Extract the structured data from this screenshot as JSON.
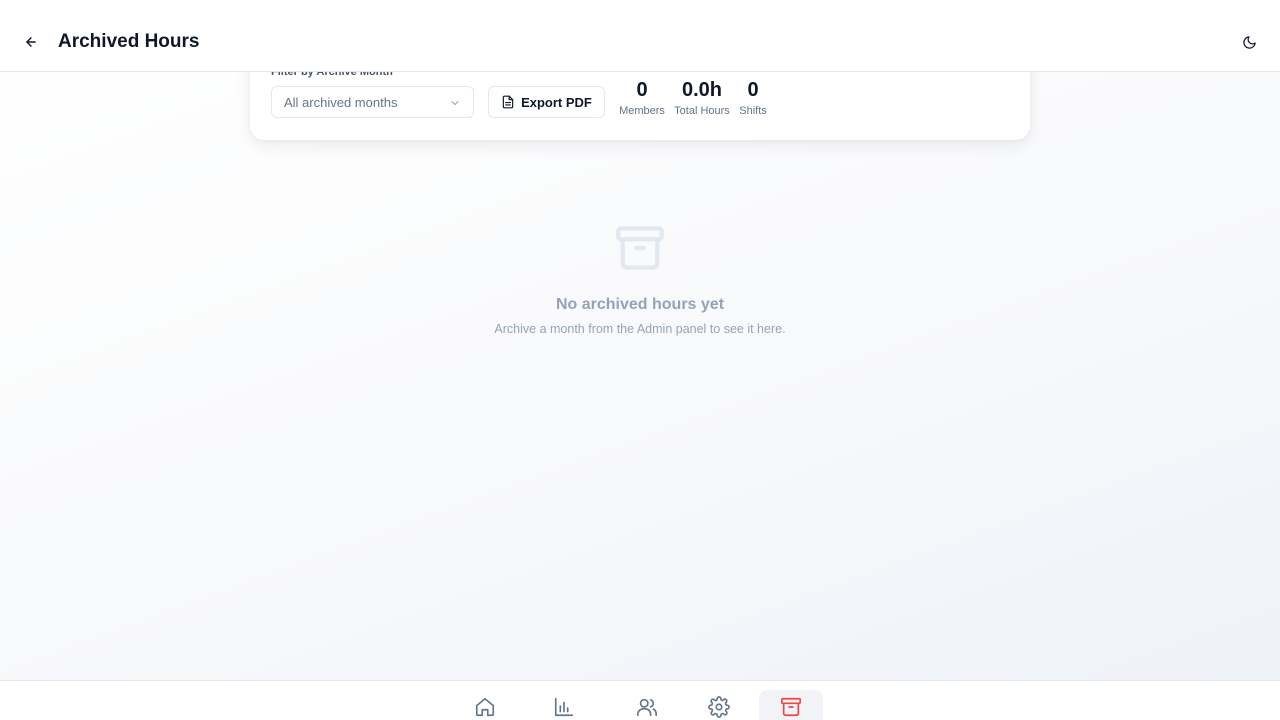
{
  "header": {
    "title": "Archived Hours",
    "back_icon": "arrow-left-icon",
    "theme_icon": "moon-icon"
  },
  "filter": {
    "label": "Filter by Archive Month",
    "select_value": "All archived months",
    "export_label": "Export PDF"
  },
  "stats": {
    "members_value": "0",
    "members_label": "Members",
    "hours_value": "0.0h",
    "hours_label": "Total Hours",
    "shifts_value": "0",
    "shifts_label": "Shifts"
  },
  "empty": {
    "icon": "archive-icon",
    "title": "No archived hours yet",
    "description": "Archive a month from the Admin panel to see it here."
  },
  "nav": {
    "items": [
      {
        "icon": "home-icon",
        "active": false
      },
      {
        "icon": "bar-chart-icon",
        "active": false
      },
      {
        "icon": "users-icon",
        "active": false
      },
      {
        "icon": "gear-icon",
        "active": false
      },
      {
        "icon": "archive-icon",
        "active": true
      }
    ],
    "active_color": "#ef4444",
    "inactive_color": "#64748b"
  }
}
